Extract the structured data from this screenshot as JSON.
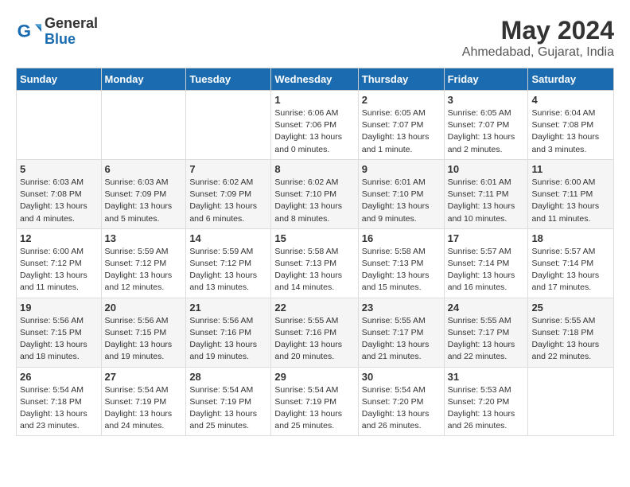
{
  "header": {
    "logo_general": "General",
    "logo_blue": "Blue",
    "title": "May 2024",
    "location": "Ahmedabad, Gujarat, India"
  },
  "weekdays": [
    "Sunday",
    "Monday",
    "Tuesday",
    "Wednesday",
    "Thursday",
    "Friday",
    "Saturday"
  ],
  "weeks": [
    [
      {
        "day": "",
        "info": ""
      },
      {
        "day": "",
        "info": ""
      },
      {
        "day": "",
        "info": ""
      },
      {
        "day": "1",
        "info": "Sunrise: 6:06 AM\nSunset: 7:06 PM\nDaylight: 13 hours\nand 0 minutes."
      },
      {
        "day": "2",
        "info": "Sunrise: 6:05 AM\nSunset: 7:07 PM\nDaylight: 13 hours\nand 1 minute."
      },
      {
        "day": "3",
        "info": "Sunrise: 6:05 AM\nSunset: 7:07 PM\nDaylight: 13 hours\nand 2 minutes."
      },
      {
        "day": "4",
        "info": "Sunrise: 6:04 AM\nSunset: 7:08 PM\nDaylight: 13 hours\nand 3 minutes."
      }
    ],
    [
      {
        "day": "5",
        "info": "Sunrise: 6:03 AM\nSunset: 7:08 PM\nDaylight: 13 hours\nand 4 minutes."
      },
      {
        "day": "6",
        "info": "Sunrise: 6:03 AM\nSunset: 7:09 PM\nDaylight: 13 hours\nand 5 minutes."
      },
      {
        "day": "7",
        "info": "Sunrise: 6:02 AM\nSunset: 7:09 PM\nDaylight: 13 hours\nand 6 minutes."
      },
      {
        "day": "8",
        "info": "Sunrise: 6:02 AM\nSunset: 7:10 PM\nDaylight: 13 hours\nand 8 minutes."
      },
      {
        "day": "9",
        "info": "Sunrise: 6:01 AM\nSunset: 7:10 PM\nDaylight: 13 hours\nand 9 minutes."
      },
      {
        "day": "10",
        "info": "Sunrise: 6:01 AM\nSunset: 7:11 PM\nDaylight: 13 hours\nand 10 minutes."
      },
      {
        "day": "11",
        "info": "Sunrise: 6:00 AM\nSunset: 7:11 PM\nDaylight: 13 hours\nand 11 minutes."
      }
    ],
    [
      {
        "day": "12",
        "info": "Sunrise: 6:00 AM\nSunset: 7:12 PM\nDaylight: 13 hours\nand 11 minutes."
      },
      {
        "day": "13",
        "info": "Sunrise: 5:59 AM\nSunset: 7:12 PM\nDaylight: 13 hours\nand 12 minutes."
      },
      {
        "day": "14",
        "info": "Sunrise: 5:59 AM\nSunset: 7:12 PM\nDaylight: 13 hours\nand 13 minutes."
      },
      {
        "day": "15",
        "info": "Sunrise: 5:58 AM\nSunset: 7:13 PM\nDaylight: 13 hours\nand 14 minutes."
      },
      {
        "day": "16",
        "info": "Sunrise: 5:58 AM\nSunset: 7:13 PM\nDaylight: 13 hours\nand 15 minutes."
      },
      {
        "day": "17",
        "info": "Sunrise: 5:57 AM\nSunset: 7:14 PM\nDaylight: 13 hours\nand 16 minutes."
      },
      {
        "day": "18",
        "info": "Sunrise: 5:57 AM\nSunset: 7:14 PM\nDaylight: 13 hours\nand 17 minutes."
      }
    ],
    [
      {
        "day": "19",
        "info": "Sunrise: 5:56 AM\nSunset: 7:15 PM\nDaylight: 13 hours\nand 18 minutes."
      },
      {
        "day": "20",
        "info": "Sunrise: 5:56 AM\nSunset: 7:15 PM\nDaylight: 13 hours\nand 19 minutes."
      },
      {
        "day": "21",
        "info": "Sunrise: 5:56 AM\nSunset: 7:16 PM\nDaylight: 13 hours\nand 19 minutes."
      },
      {
        "day": "22",
        "info": "Sunrise: 5:55 AM\nSunset: 7:16 PM\nDaylight: 13 hours\nand 20 minutes."
      },
      {
        "day": "23",
        "info": "Sunrise: 5:55 AM\nSunset: 7:17 PM\nDaylight: 13 hours\nand 21 minutes."
      },
      {
        "day": "24",
        "info": "Sunrise: 5:55 AM\nSunset: 7:17 PM\nDaylight: 13 hours\nand 22 minutes."
      },
      {
        "day": "25",
        "info": "Sunrise: 5:55 AM\nSunset: 7:18 PM\nDaylight: 13 hours\nand 22 minutes."
      }
    ],
    [
      {
        "day": "26",
        "info": "Sunrise: 5:54 AM\nSunset: 7:18 PM\nDaylight: 13 hours\nand 23 minutes."
      },
      {
        "day": "27",
        "info": "Sunrise: 5:54 AM\nSunset: 7:19 PM\nDaylight: 13 hours\nand 24 minutes."
      },
      {
        "day": "28",
        "info": "Sunrise: 5:54 AM\nSunset: 7:19 PM\nDaylight: 13 hours\nand 25 minutes."
      },
      {
        "day": "29",
        "info": "Sunrise: 5:54 AM\nSunset: 7:19 PM\nDaylight: 13 hours\nand 25 minutes."
      },
      {
        "day": "30",
        "info": "Sunrise: 5:54 AM\nSunset: 7:20 PM\nDaylight: 13 hours\nand 26 minutes."
      },
      {
        "day": "31",
        "info": "Sunrise: 5:53 AM\nSunset: 7:20 PM\nDaylight: 13 hours\nand 26 minutes."
      },
      {
        "day": "",
        "info": ""
      }
    ]
  ]
}
